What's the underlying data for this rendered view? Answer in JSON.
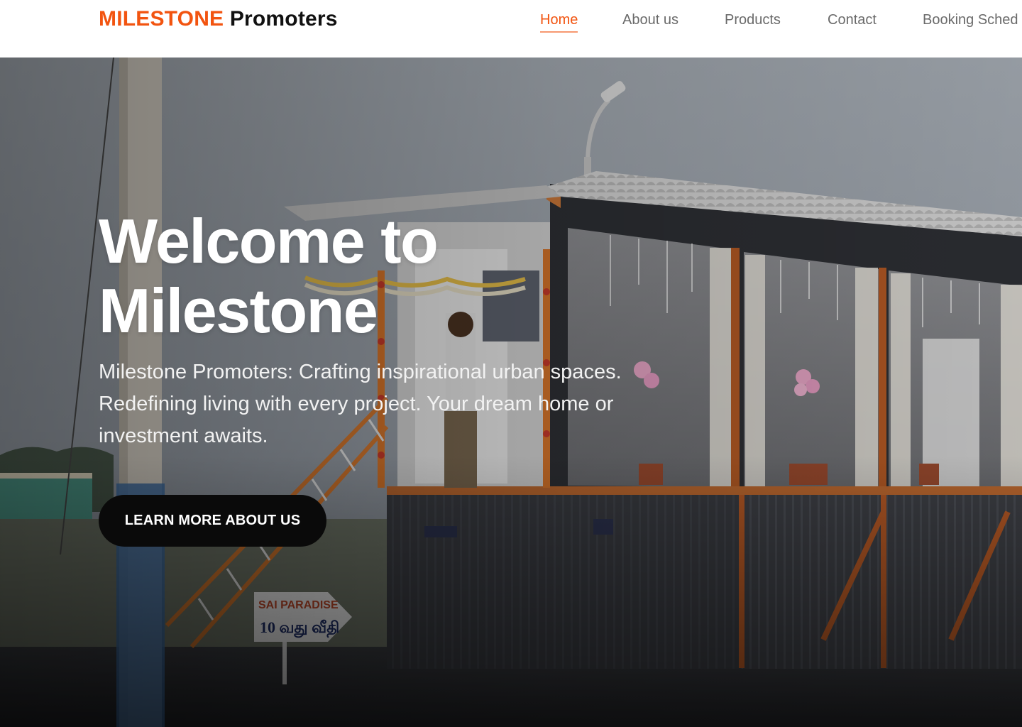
{
  "header": {
    "logo": {
      "accent": "MILESTONE",
      "rest": "Promoters"
    },
    "nav": [
      {
        "label": "Home",
        "active": true
      },
      {
        "label": "About us",
        "active": false
      },
      {
        "label": "Products",
        "active": false
      },
      {
        "label": "Contact",
        "active": false
      },
      {
        "label": "Booking Sched",
        "active": false
      }
    ]
  },
  "hero": {
    "title_line1": "Welcome to",
    "title_line2": "Milestone",
    "description": "Milestone Promoters: Crafting inspirational urban spaces. Redefining living with every project. Your dream home or investment awaits.",
    "button_label": "LEARN MORE ABOUT US",
    "photo_icon": "photo-container-office"
  },
  "colors": {
    "brand": "#f25410",
    "text_dark": "#111111",
    "nav_text": "#6a6a6a",
    "button_bg": "#0a0a0a",
    "hero_text": "#ffffff"
  }
}
